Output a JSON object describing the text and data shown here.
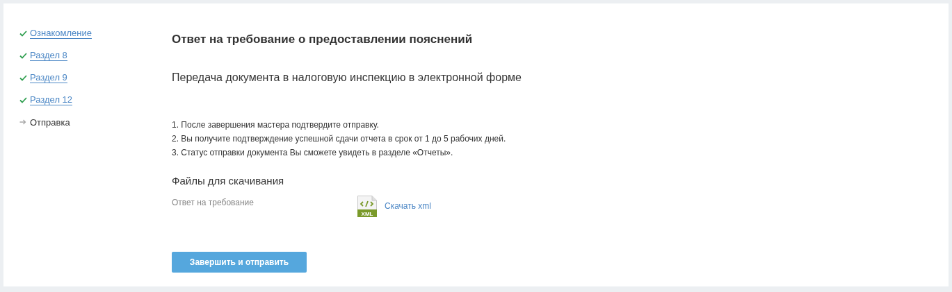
{
  "steps": [
    {
      "label": "Ознакомление",
      "completed": true
    },
    {
      "label": "Раздел 8",
      "completed": true
    },
    {
      "label": "Раздел 9",
      "completed": true
    },
    {
      "label": "Раздел 12",
      "completed": true
    },
    {
      "label": "Отправка",
      "completed": false
    }
  ],
  "title": "Ответ на требование о предоставлении пояснений",
  "subtitle": "Передача документа в налоговую инспекцию в электронной форме",
  "instructions": [
    "1. После завершения мастера подтвердите отправку.",
    "2. Вы получите подтверждение успешной сдачи отчета в срок от 1 до 5 рабочих дней.",
    "3. Статус отправки документа Вы сможете увидеть в разделе «Отчеты»."
  ],
  "downloads": {
    "heading": "Файлы для скачивания",
    "files": [
      {
        "label": "Ответ на требование",
        "file_type": "XML",
        "link": "Скачать xml"
      }
    ]
  },
  "submit_button": "Завершить и отправить"
}
